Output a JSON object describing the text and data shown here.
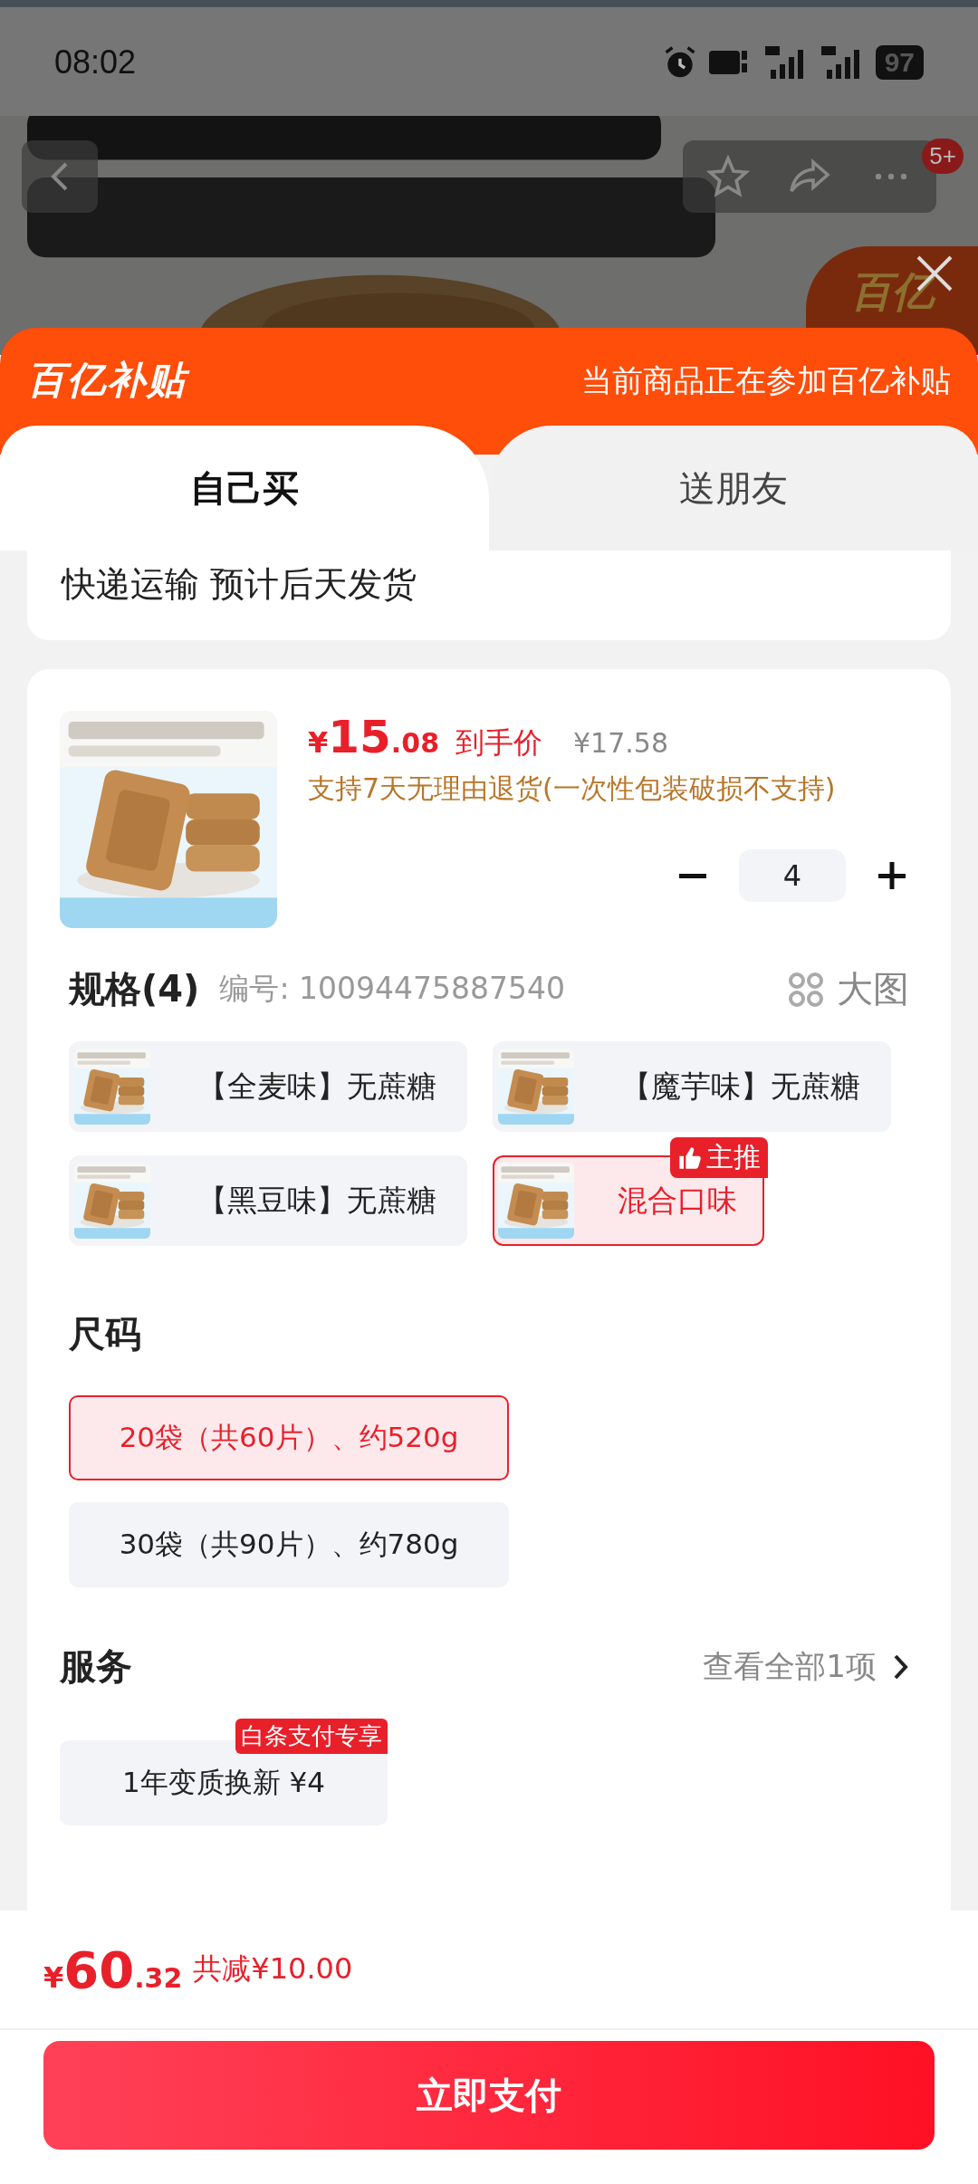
{
  "status_bar": {
    "time": "08:02",
    "battery": "97"
  },
  "nav": {
    "badge": "5+"
  },
  "float_badge": {
    "label": "百亿"
  },
  "subsidy_banner": {
    "title": "百亿补贴",
    "message": "当前商品正在参加百亿补贴"
  },
  "tabs": [
    {
      "label": "自己买",
      "selected": true
    },
    {
      "label": "送朋友",
      "selected": false
    }
  ],
  "delivery": "快递运输 预计后天发货",
  "product": {
    "price_symbol": "¥",
    "price_main": "15",
    "price_decimal": ".08",
    "price_label": "到手价",
    "original_price": "¥17.58",
    "return_policy": "支持7天无理由退货(一次性包装破损不支持)",
    "quantity": "4"
  },
  "spec": {
    "title": "规格(4)",
    "code": "编号: 10094475887540",
    "view_large": "大图",
    "options": [
      {
        "label": "【全麦味】无蔗糖",
        "selected": false
      },
      {
        "label": "【魔芋味】无蔗糖",
        "selected": false
      },
      {
        "label": "【黑豆味】无蔗糖",
        "selected": false
      },
      {
        "label": "混合口味",
        "selected": true,
        "badge": "主推"
      }
    ]
  },
  "size": {
    "title": "尺码",
    "options": [
      {
        "label": "20袋（共60片）、约520g",
        "selected": true
      },
      {
        "label": "30袋（共90片）、约780g",
        "selected": false
      }
    ]
  },
  "service": {
    "title": "服务",
    "view_all": "查看全部1项",
    "options": [
      {
        "label": "1年变质换新 ¥4",
        "badge": "白条支付专享",
        "selected": false
      }
    ]
  },
  "footer": {
    "total_symbol": "¥",
    "total_main": "60",
    "total_decimal": ".32",
    "discount": "共减¥10.00",
    "pay_button": "立即支付"
  }
}
